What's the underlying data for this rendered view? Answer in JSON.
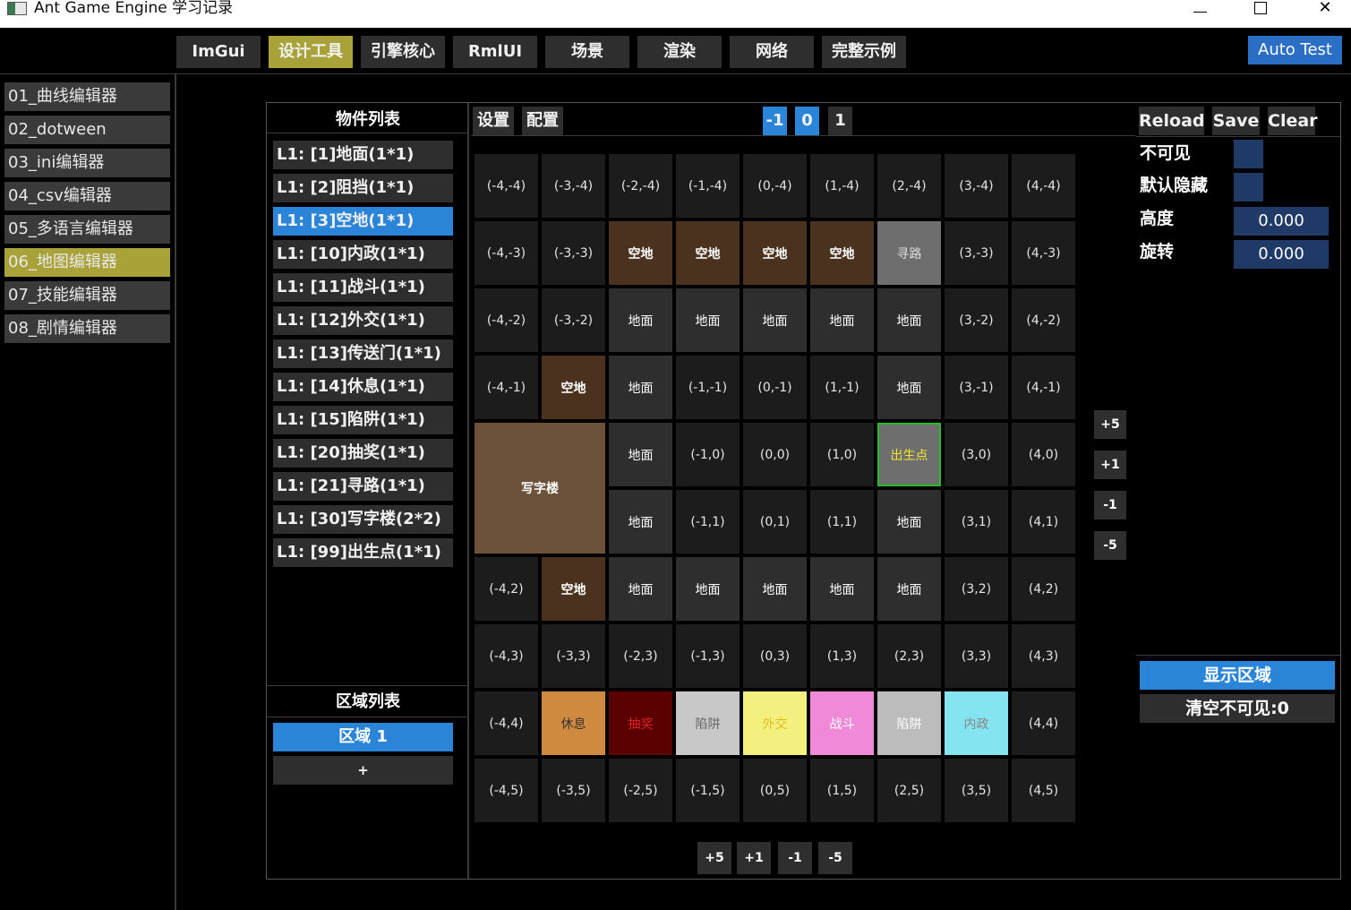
{
  "window": {
    "title": "Ant Game Engine 学习记录",
    "minimize_icon": "minimize-icon",
    "maximize_icon": "maximize-icon",
    "close_glyph": "✕"
  },
  "menu": {
    "tabs": [
      "ImGui",
      "设计工具",
      "引擎核心",
      "RmlUI",
      "场景",
      "渲染",
      "网络",
      "完整示例"
    ],
    "active": "设计工具",
    "auto_test": "Auto Test"
  },
  "sidebar": {
    "items": [
      "01_曲线编辑器",
      "02_dotween",
      "03_ini编辑器",
      "04_csv编辑器",
      "05_多语言编辑器",
      "06_地图编辑器",
      "07_技能编辑器",
      "08_剧情编辑器"
    ],
    "active": "06_地图编辑器"
  },
  "objects": {
    "title": "物件列表",
    "items": [
      "L1: [1]地面(1*1)",
      "L1: [2]阻挡(1*1)",
      "L1: [3]空地(1*1)",
      "L1: [10]内政(1*1)",
      "L1: [11]战斗(1*1)",
      "L1: [12]外交(1*1)",
      "L1: [13]传送门(1*1)",
      "L1: [14]休息(1*1)",
      "L1: [15]陷阱(1*1)",
      "L1: [20]抽奖(1*1)",
      "L1: [21]寻路(1*1)",
      "L1: [30]写字楼(2*2)",
      "L1: [99]出生点(1*1)"
    ],
    "selected": "L1: [3]空地(1*1)"
  },
  "regions": {
    "title": "区域列表",
    "items": [
      "区域 1"
    ],
    "add": "+"
  },
  "grid_toolbar": {
    "settings": "设置",
    "config": "配置",
    "layers": [
      "-1",
      "0",
      "1"
    ],
    "active_layer": "-1"
  },
  "grid": {
    "rows": [
      [
        [
          "(-4,-4)",
          ""
        ],
        [
          "(-3,-4)",
          ""
        ],
        [
          "(-2,-4)",
          ""
        ],
        [
          "(-1,-4)",
          ""
        ],
        [
          "(0,-4)",
          ""
        ],
        [
          "(1,-4)",
          ""
        ],
        [
          "(2,-4)",
          ""
        ],
        [
          "(3,-4)",
          ""
        ],
        [
          "(4,-4)",
          ""
        ]
      ],
      [
        [
          "(-4,-3)",
          ""
        ],
        [
          "(-3,-3)",
          ""
        ],
        [
          "空地",
          "kongdi"
        ],
        [
          "空地",
          "kongdi"
        ],
        [
          "空地",
          "kongdi"
        ],
        [
          "空地",
          "kongdi"
        ],
        [
          "寻路",
          "xunlu"
        ],
        [
          "(3,-3)",
          ""
        ],
        [
          "(4,-3)",
          ""
        ]
      ],
      [
        [
          "(-4,-2)",
          ""
        ],
        [
          "(-3,-2)",
          ""
        ],
        [
          "地面",
          "dimian"
        ],
        [
          "地面",
          "dimian"
        ],
        [
          "地面",
          "dimian"
        ],
        [
          "地面",
          "dimian"
        ],
        [
          "地面",
          "dimian"
        ],
        [
          "(3,-2)",
          ""
        ],
        [
          "(4,-2)",
          ""
        ]
      ],
      [
        [
          "(-4,-1)",
          ""
        ],
        [
          "空地",
          "kongdi"
        ],
        [
          "地面",
          "dimian"
        ],
        [
          "(-1,-1)",
          ""
        ],
        [
          "(0,-1)",
          ""
        ],
        [
          "(1,-1)",
          ""
        ],
        [
          "地面",
          "dimian"
        ],
        [
          "(3,-1)",
          ""
        ],
        [
          "(4,-1)",
          ""
        ]
      ],
      [
        null,
        null,
        [
          "地面",
          "dimian"
        ],
        [
          "(-1,0)",
          ""
        ],
        [
          "(0,0)",
          ""
        ],
        [
          "(1,0)",
          ""
        ],
        [
          "出生点",
          "spawn"
        ],
        [
          "(3,0)",
          ""
        ],
        [
          "(4,0)",
          ""
        ]
      ],
      [
        null,
        null,
        [
          "地面",
          "dimian"
        ],
        [
          "(-1,1)",
          ""
        ],
        [
          "(0,1)",
          ""
        ],
        [
          "(1,1)",
          ""
        ],
        [
          "地面",
          "dimian"
        ],
        [
          "(3,1)",
          ""
        ],
        [
          "(4,1)",
          ""
        ]
      ],
      [
        [
          "(-4,2)",
          ""
        ],
        [
          "空地",
          "kongdi"
        ],
        [
          "地面",
          "dimian"
        ],
        [
          "地面",
          "dimian"
        ],
        [
          "地面",
          "dimian"
        ],
        [
          "地面",
          "dimian"
        ],
        [
          "地面",
          "dimian"
        ],
        [
          "(3,2)",
          ""
        ],
        [
          "(4,2)",
          ""
        ]
      ],
      [
        [
          "(-4,3)",
          ""
        ],
        [
          "(-3,3)",
          ""
        ],
        [
          "(-2,3)",
          ""
        ],
        [
          "(-1,3)",
          ""
        ],
        [
          "(0,3)",
          ""
        ],
        [
          "(1,3)",
          ""
        ],
        [
          "(2,3)",
          ""
        ],
        [
          "(3,3)",
          ""
        ],
        [
          "(4,3)",
          ""
        ]
      ],
      [
        [
          "(-4,4)",
          ""
        ],
        [
          "休息",
          "rest"
        ],
        [
          "抽奖",
          "lottery"
        ],
        [
          "陷阱",
          "trap"
        ],
        [
          "外交",
          "diplo"
        ],
        [
          "战斗",
          "battle"
        ],
        [
          "陷阱",
          "trap2"
        ],
        [
          "内政",
          "internal"
        ],
        [
          "(4,4)",
          ""
        ]
      ],
      [
        [
          "(-4,5)",
          ""
        ],
        [
          "(-3,5)",
          ""
        ],
        [
          "(-2,5)",
          ""
        ],
        [
          "(-1,5)",
          ""
        ],
        [
          "(0,5)",
          ""
        ],
        [
          "(1,5)",
          ""
        ],
        [
          "(2,5)",
          ""
        ],
        [
          "(3,5)",
          ""
        ],
        [
          "(4,5)",
          ""
        ]
      ]
    ],
    "building": "写字楼",
    "side_steps": [
      "+5",
      "+1",
      "-1",
      "-5"
    ],
    "bottom_steps": [
      "+5",
      "+1",
      "-1",
      "-5"
    ]
  },
  "properties": {
    "buttons": [
      "Reload",
      "Save",
      "Clear"
    ],
    "invisible_label": "不可见",
    "hidden_label": "默认隐藏",
    "height_label": "高度",
    "height_value": "0.000",
    "rotation_label": "旋转",
    "rotation_value": "0.000",
    "show_region": "显示区域",
    "clear_invisible": "清空不可见:0"
  }
}
